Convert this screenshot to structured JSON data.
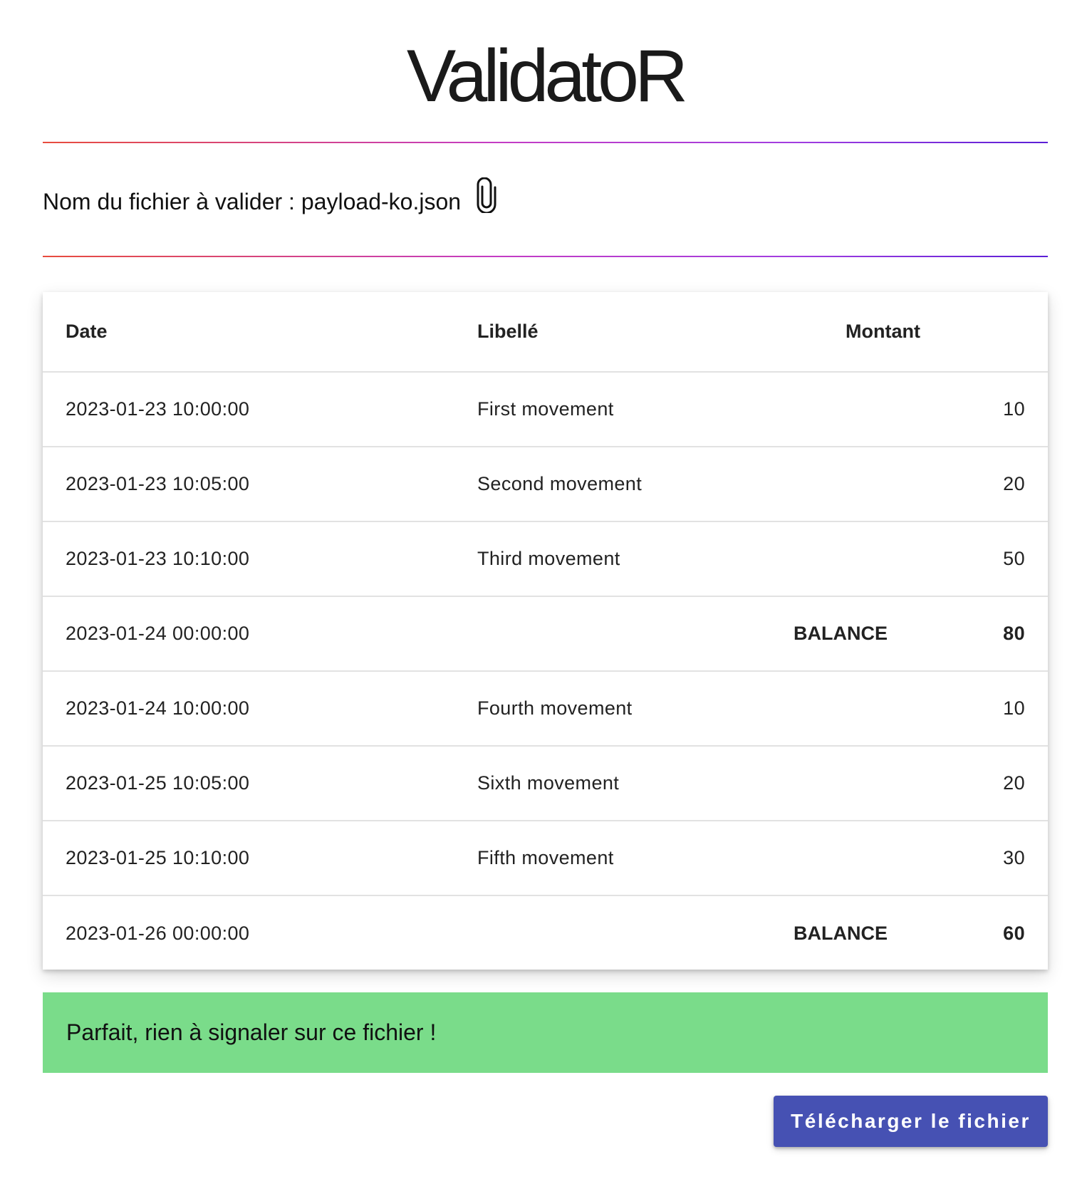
{
  "app": {
    "title": "ValidatoR"
  },
  "file": {
    "label": "Nom du fichier à valider :",
    "name": "payload-ko.json",
    "icon": "paperclip-icon"
  },
  "table": {
    "headers": {
      "date": "Date",
      "label": "Libellé",
      "amount": "Montant"
    },
    "rows": [
      {
        "date": "2023-01-23 10:00:00",
        "label": "First movement",
        "amount": "10"
      },
      {
        "date": "2023-01-23 10:05:00",
        "label": "Second movement",
        "amount": "20"
      },
      {
        "date": "2023-01-23 10:10:00",
        "label": "Third movement",
        "amount": "50"
      },
      {
        "date": "2023-01-24 00:00:00",
        "balance_label": "BALANCE",
        "amount": "80"
      },
      {
        "date": "2023-01-24 10:00:00",
        "label": "Fourth movement",
        "amount": "10"
      },
      {
        "date": "2023-01-25 10:05:00",
        "label": "Sixth movement",
        "amount": "20"
      },
      {
        "date": "2023-01-25 10:10:00",
        "label": "Fifth movement",
        "amount": "30"
      },
      {
        "date": "2023-01-26 00:00:00",
        "balance_label": "BALANCE",
        "amount": "60"
      }
    ]
  },
  "status": {
    "message": "Parfait, rien à signaler sur ce fichier !",
    "color": "#7adc8a"
  },
  "actions": {
    "download_label": "Télécharger le fichier",
    "download_color": "#4651b3"
  }
}
